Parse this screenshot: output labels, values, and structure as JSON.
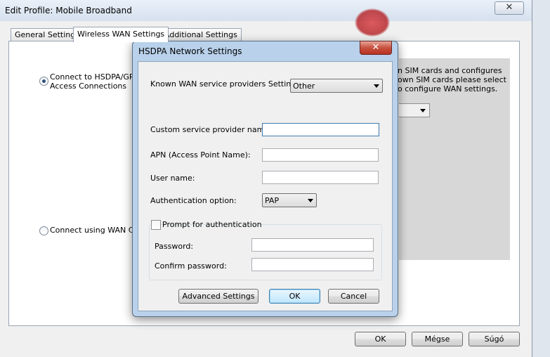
{
  "outer_window": {
    "title": "Edit Profile: Mobile Broadband",
    "close_glyph": "✕",
    "tabs": [
      {
        "label": "General Settings",
        "active": false
      },
      {
        "label": "Wireless WAN Settings",
        "active": true
      },
      {
        "label": "Additional Settings",
        "active": false
      }
    ],
    "radio_hsdpa_line1": "Connect to HSDPA/GPRS",
    "radio_hsdpa_line2": "Access Connections",
    "radio_wan_label": "Connect using WAN Conn",
    "info_lines": [
      "n SIM cards and configures",
      "own SIM cards please select",
      "o configure WAN settings."
    ],
    "buttons": {
      "ok": "OK",
      "cancel": "Mégse",
      "help": "Súgó"
    }
  },
  "dialog": {
    "title": "HSDPA Network Settings",
    "close_glyph": "✕",
    "known_providers_label": "Known WAN service providers Settings:",
    "known_providers_value": "Other",
    "custom_provider_label": "Custom service provider name:",
    "custom_provider_value": "",
    "apn_label": "APN (Access Point Name):",
    "apn_value": "",
    "username_label": "User name:",
    "username_value": "",
    "auth_label": "Authentication option:",
    "auth_value": "PAP",
    "prompt_auth_label": "Prompt for authentication",
    "prompt_auth_checked": false,
    "password_label": "Password:",
    "password_value": "",
    "confirm_password_label": "Confirm password:",
    "confirm_password_value": "",
    "buttons": {
      "advanced": "Advanced Settings",
      "ok": "OK",
      "cancel": "Cancel"
    }
  },
  "colors": {
    "dialog_frame": "#b9d1ea",
    "close_red": "#c7513f",
    "info_panel": "#d7d7d7"
  }
}
